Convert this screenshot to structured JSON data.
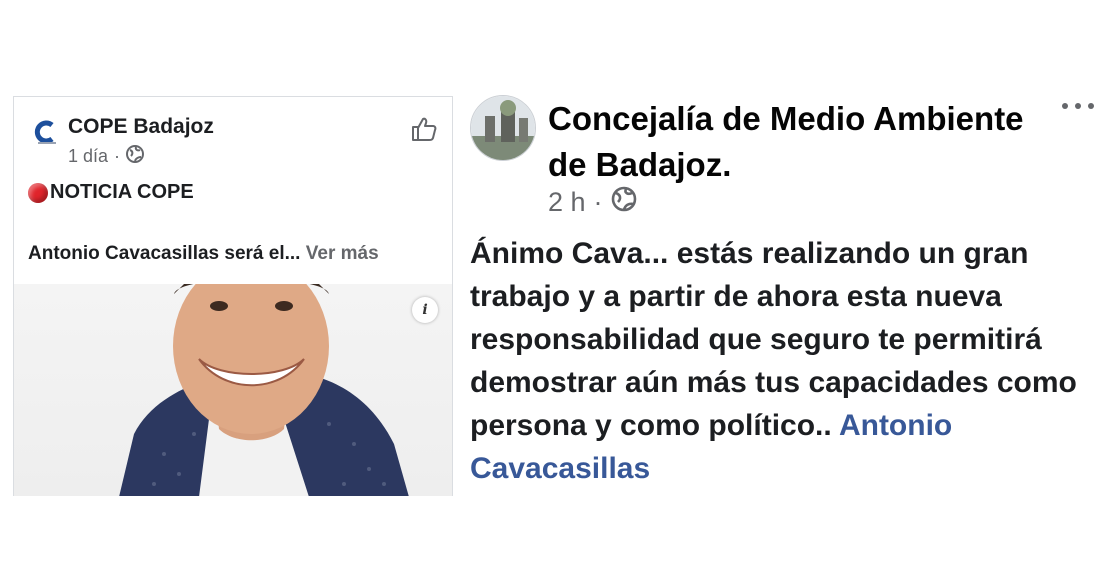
{
  "embedded_post": {
    "page_name": "COPE Badajoz",
    "time": "1 día",
    "separator": "·",
    "headline": "NOTICIA COPE",
    "summary": "Antonio Cavacasillas será el...",
    "see_more": "Ver más",
    "info_label": "i",
    "icons": {
      "logo": "cope-logo-icon",
      "privacy": "globe-icon",
      "like": "thumbs-up-icon",
      "headline_marker": "red-circle-icon"
    }
  },
  "post": {
    "author": "Concejalía de Medio Ambiente de Badajoz.",
    "time": "2 h",
    "separator": "·",
    "body_text": "Ánimo Cava... estás realizando un gran trabajo y a partir de ahora esta nueva responsabilidad que seguro te permitirá demostrar aún más tus capacidades como persona y como político.. ",
    "mention": "Antonio Cavacasillas",
    "icons": {
      "privacy": "globe-icon",
      "menu": "more-options-icon"
    }
  },
  "colors": {
    "link": "#385898",
    "secondary_text": "#65676b",
    "red_marker": "#e0242b",
    "cope_blue": "#1d4f9c"
  }
}
